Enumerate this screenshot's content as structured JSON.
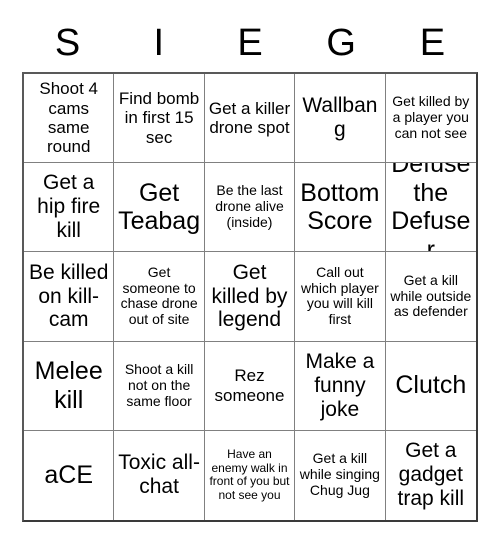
{
  "card": {
    "header_letters": [
      "S",
      "I",
      "E",
      "G",
      "E"
    ],
    "rows": [
      [
        {
          "text": "Shoot 4 cams same round",
          "size": "fs-md"
        },
        {
          "text": "Find bomb in first 15 sec",
          "size": "fs-md"
        },
        {
          "text": "Get a killer drone spot",
          "size": "fs-md"
        },
        {
          "text": "Wallbang",
          "size": "fs-lg"
        },
        {
          "text": "Get killed by a player you can not see",
          "size": "fs-sm"
        }
      ],
      [
        {
          "text": "Get a hip fire kill",
          "size": "fs-lg"
        },
        {
          "text": "Get Teabag",
          "size": "fs-xl"
        },
        {
          "text": "Be the last drone alive (inside)",
          "size": "fs-sm"
        },
        {
          "text": "Bottom Score",
          "size": "fs-xl"
        },
        {
          "text": "Defuse the Defuser",
          "size": "fs-xl"
        }
      ],
      [
        {
          "text": "Be killed on kill-cam",
          "size": "fs-lg"
        },
        {
          "text": "Get someone to chase drone out of site",
          "size": "fs-sm"
        },
        {
          "text": "Get killed by legend",
          "size": "fs-lg"
        },
        {
          "text": "Call out which player you will kill first",
          "size": "fs-sm"
        },
        {
          "text": "Get a kill while outside as defender",
          "size": "fs-sm"
        }
      ],
      [
        {
          "text": "Melee kill",
          "size": "fs-xl"
        },
        {
          "text": "Shoot a kill not on the same floor",
          "size": "fs-sm"
        },
        {
          "text": "Rez someone",
          "size": "fs-md"
        },
        {
          "text": "Make a funny joke",
          "size": "fs-lg"
        },
        {
          "text": "Clutch",
          "size": "fs-xl"
        }
      ],
      [
        {
          "text": "aCE",
          "size": "fs-xl"
        },
        {
          "text": "Toxic all-chat",
          "size": "fs-lg"
        },
        {
          "text": "Have an enemy walk in front of you but not see you",
          "size": "fs-xs"
        },
        {
          "text": "Get a kill while singing Chug Jug",
          "size": "fs-sm"
        },
        {
          "text": "Get a gadget trap kill",
          "size": "fs-lg"
        }
      ]
    ]
  }
}
